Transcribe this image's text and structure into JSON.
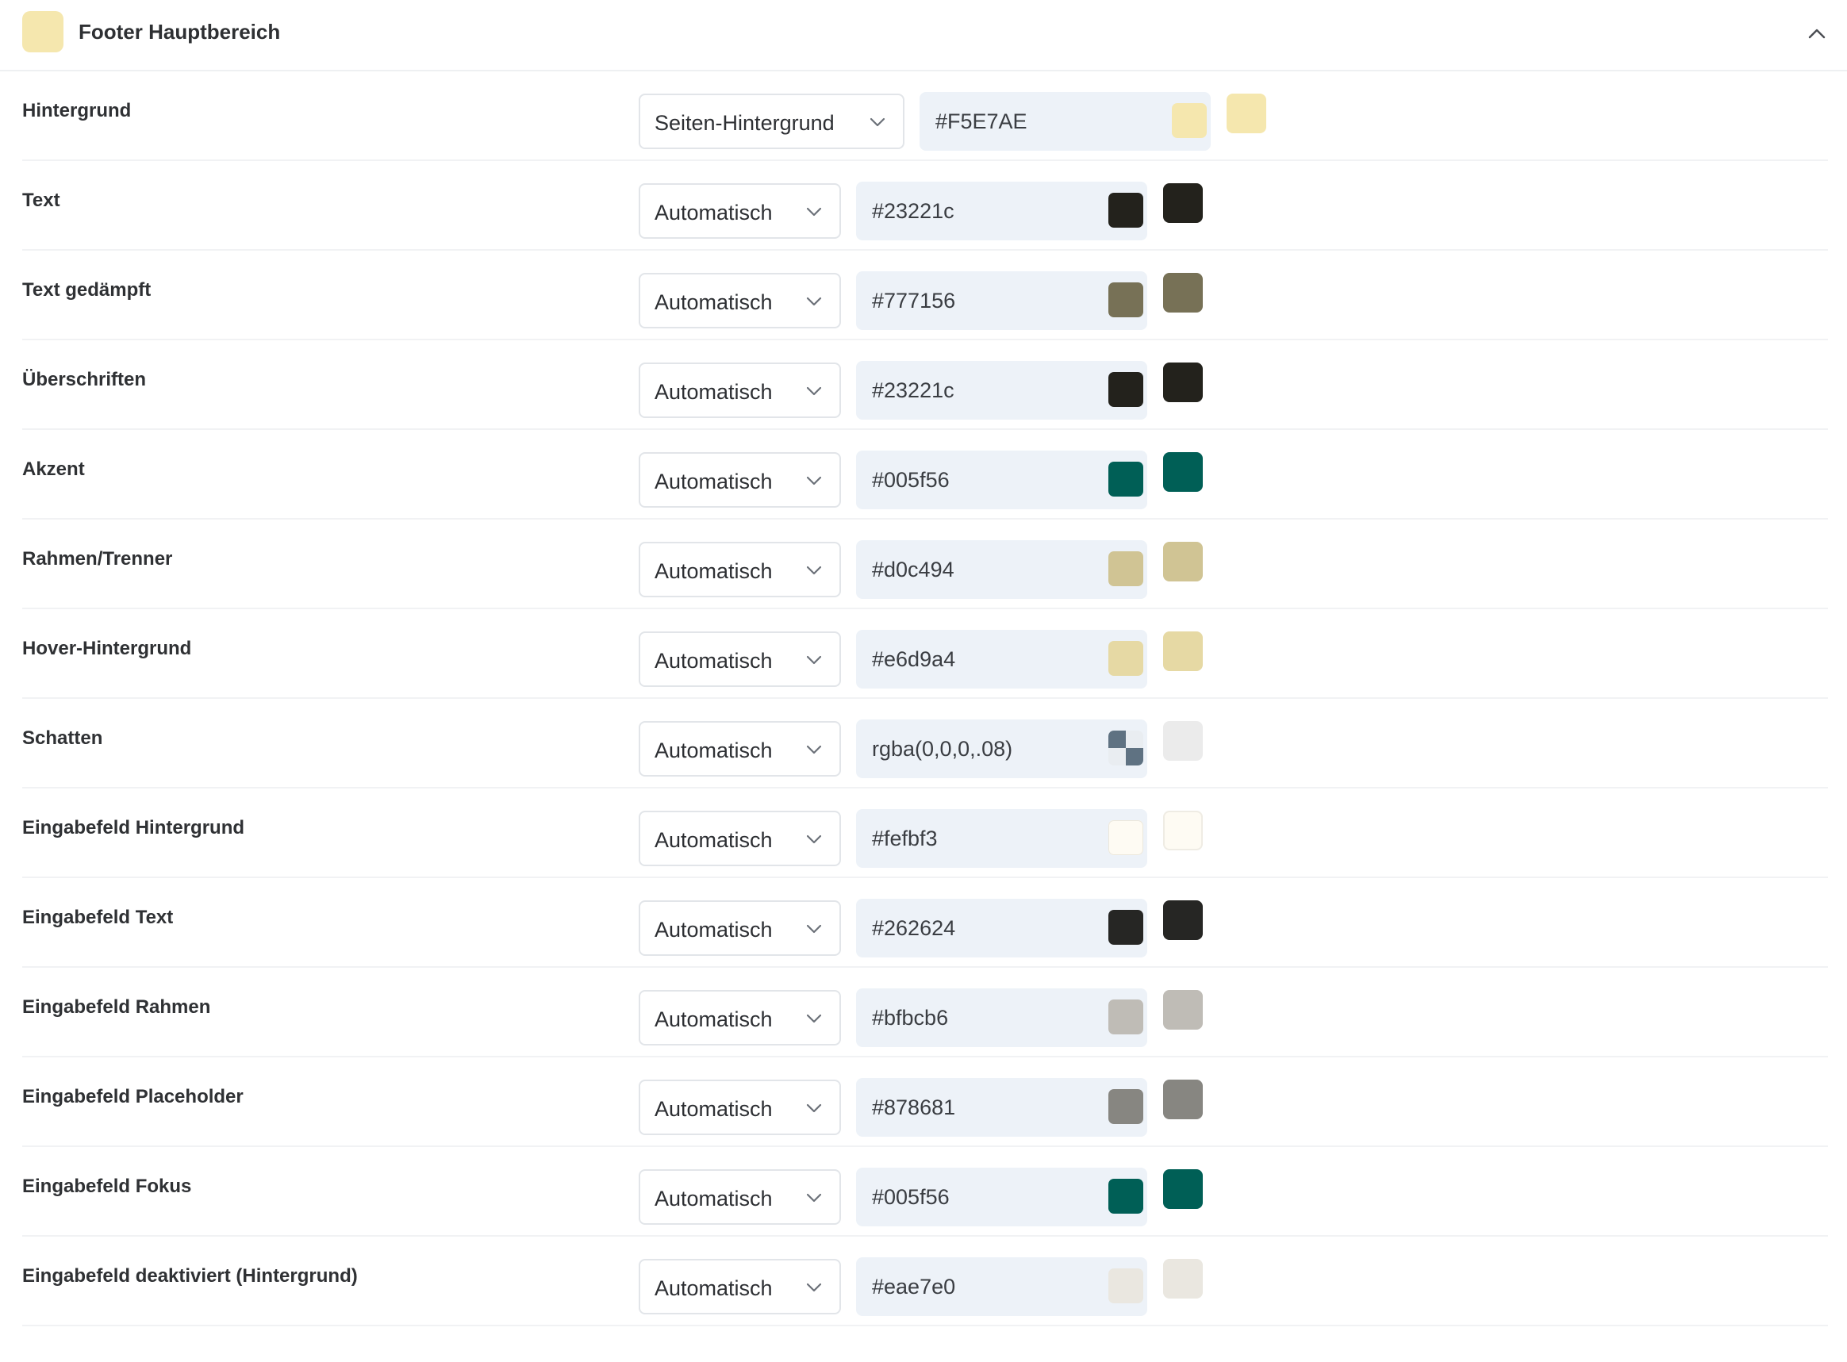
{
  "header": {
    "title": "Footer Hauptbereich",
    "swatch_color": "#F5E7AE",
    "collapse_icon": "chevron-up-icon"
  },
  "rows": [
    {
      "label": "Hintergrund",
      "mode": "Seiten-Hintergrund",
      "value": "#F5E7AE",
      "color": "#F5E7AE"
    },
    {
      "label": "Text",
      "mode": "Automatisch",
      "value": "#23221c",
      "color": "#23221c"
    },
    {
      "label": "Text gedämpft",
      "mode": "Automatisch",
      "value": "#777156",
      "color": "#777156"
    },
    {
      "label": "Überschriften",
      "mode": "Automatisch",
      "value": "#23221c",
      "color": "#23221c"
    },
    {
      "label": "Akzent",
      "mode": "Automatisch",
      "value": "#005f56",
      "color": "#005f56"
    },
    {
      "label": "Rahmen/Trenner",
      "mode": "Automatisch",
      "value": "#d0c494",
      "color": "#d0c494"
    },
    {
      "label": "Hover-Hintergrund",
      "mode": "Automatisch",
      "value": "#e6d9a4",
      "color": "#e6d9a4"
    },
    {
      "label": "Schatten",
      "mode": "Automatisch",
      "value": "rgba(0,0,0,.08)",
      "color": "rgba(0,0,0,.08)"
    },
    {
      "label": "Eingabefeld Hintergrund",
      "mode": "Automatisch",
      "value": "#fefbf3",
      "color": "#fefbf3"
    },
    {
      "label": "Eingabefeld Text",
      "mode": "Automatisch",
      "value": "#262624",
      "color": "#262624"
    },
    {
      "label": "Eingabefeld Rahmen",
      "mode": "Automatisch",
      "value": "#bfbcb6",
      "color": "#bfbcb6"
    },
    {
      "label": "Eingabefeld Placeholder",
      "mode": "Automatisch",
      "value": "#878681",
      "color": "#878681"
    },
    {
      "label": "Eingabefeld Fokus",
      "mode": "Automatisch",
      "value": "#005f56",
      "color": "#005f56"
    },
    {
      "label": "Eingabefeld deaktiviert (Hintergrund)",
      "mode": "Automatisch",
      "value": "#eae7e0",
      "color": "#eae7e0"
    }
  ]
}
